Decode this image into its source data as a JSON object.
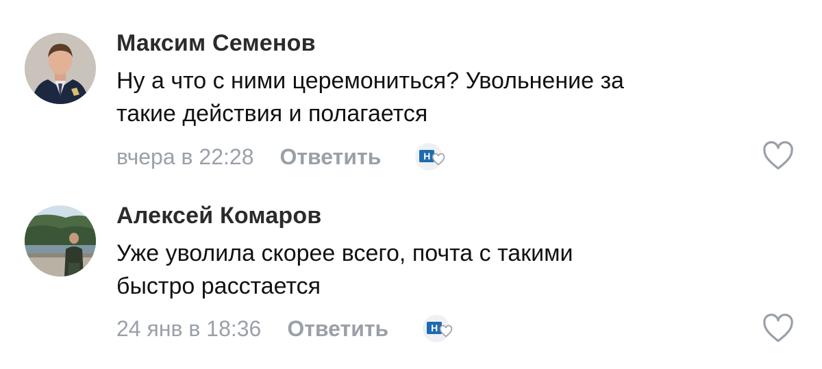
{
  "comments": [
    {
      "author": "Максим Семенов",
      "text_lines": [
        "Ну а что с ними церемониться? Увольнение за",
        "такие действия и полагается"
      ],
      "date": "вчера в 22:28",
      "reply_label": "Ответить",
      "badge_logo_text": "Н",
      "avatar": "person-in-uniform"
    },
    {
      "author": "Алексей Комаров",
      "text_lines": [
        "Уже уволила скорее всего, почта с такими",
        "быстро расстается"
      ],
      "date": "24 янв в 18:36",
      "reply_label": "Ответить",
      "badge_logo_text": "Н",
      "avatar": "person-outdoors-landscape"
    }
  ],
  "icons": {
    "like": "heart-outline-icon",
    "badge": "newspaper-heart-icon"
  },
  "colors": {
    "meta_text": "#9aa0a8",
    "author_text": "#2b2b2b",
    "body_text": "#111111",
    "badge_blue": "#1e6bb0",
    "background": "#ffffff"
  }
}
